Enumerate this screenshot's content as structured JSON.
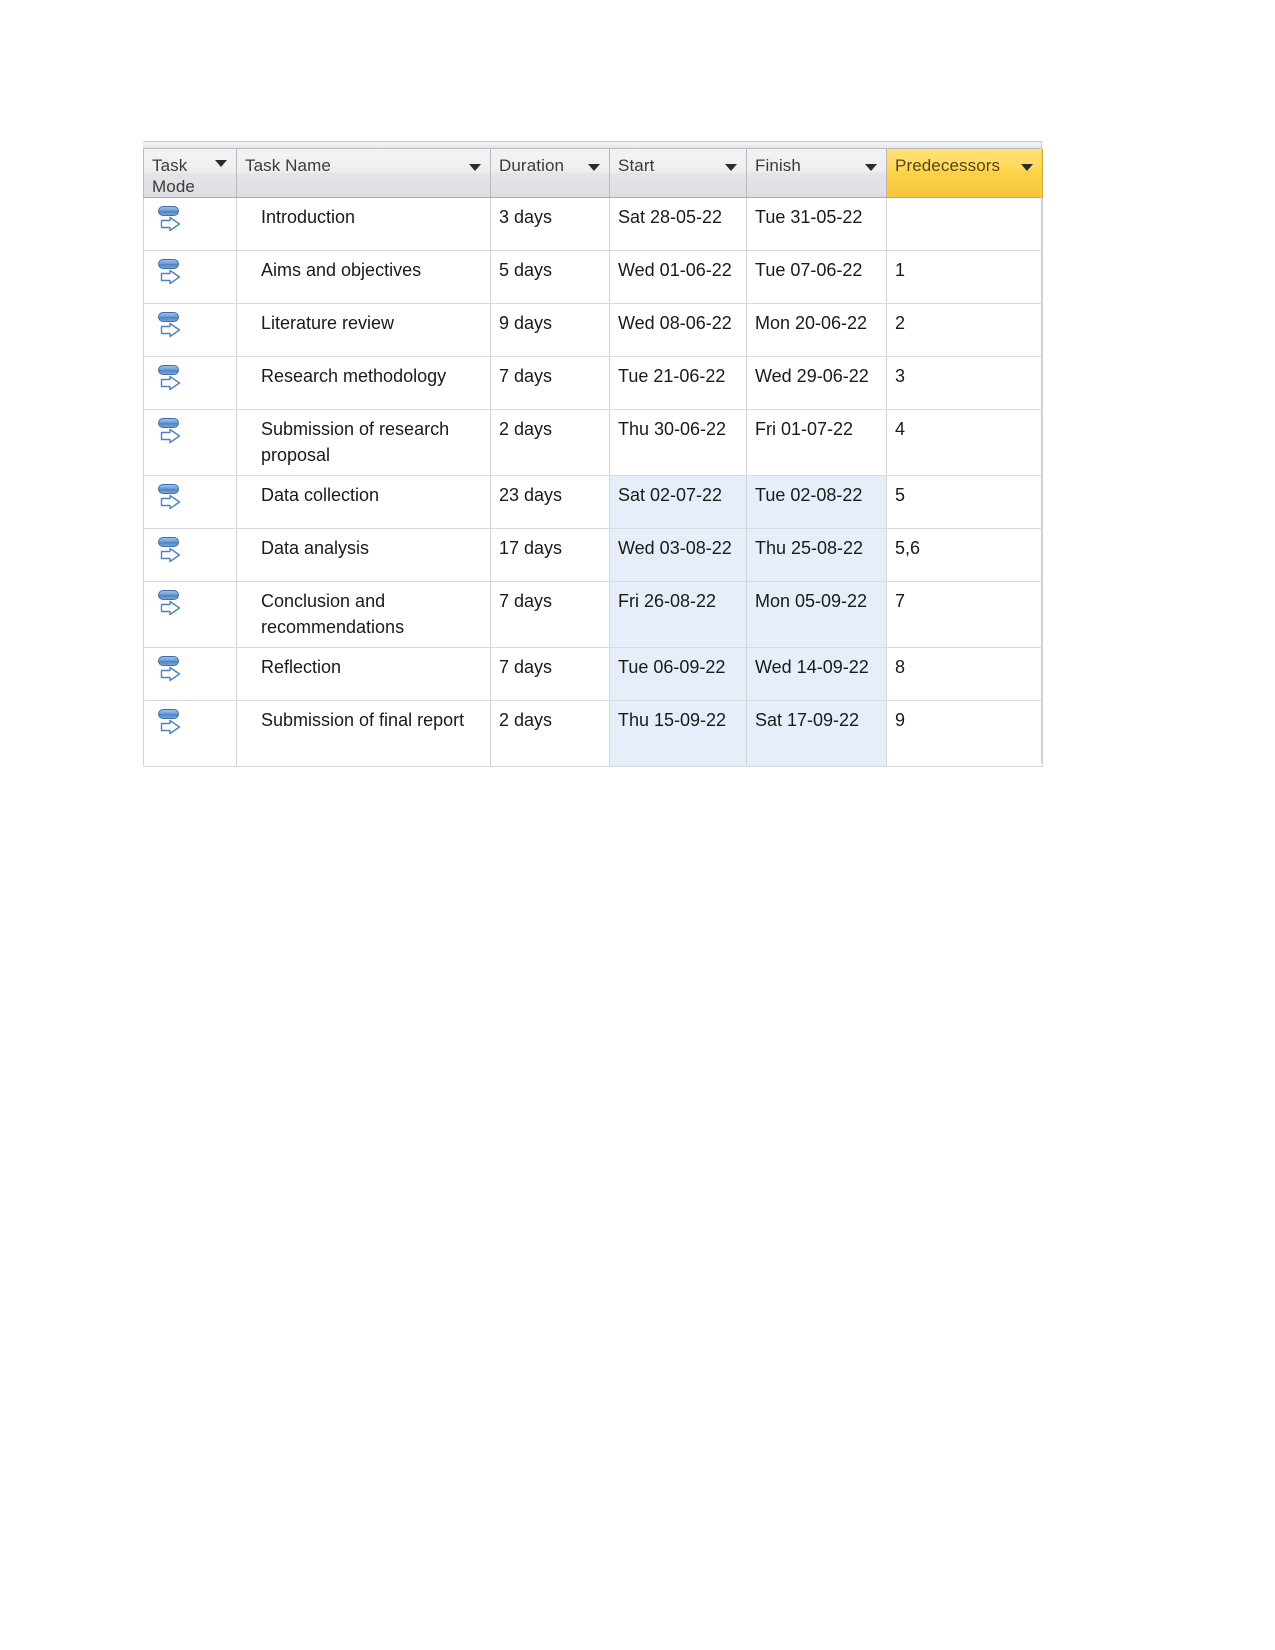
{
  "table": {
    "columns": [
      {
        "id": "task_mode",
        "label_line1": "Task",
        "label_line2": "Mode",
        "has_filter": true,
        "highlighted": false
      },
      {
        "id": "task_name",
        "label_line1": "Task Name",
        "label_line2": "",
        "has_filter": true,
        "highlighted": false
      },
      {
        "id": "duration",
        "label_line1": "Duration",
        "label_line2": "",
        "has_filter": true,
        "highlighted": false
      },
      {
        "id": "start",
        "label_line1": "Start",
        "label_line2": "",
        "has_filter": true,
        "highlighted": false
      },
      {
        "id": "finish",
        "label_line1": "Finish",
        "label_line2": "",
        "has_filter": true,
        "highlighted": false
      },
      {
        "id": "predecessors",
        "label_line1": "Predecessors",
        "label_line2": "",
        "has_filter": true,
        "highlighted": true
      }
    ],
    "rows": [
      {
        "task_mode_icon": "auto-scheduled-icon",
        "task_name": "Introduction",
        "duration": "3 days",
        "start": "Sat 28-05-22",
        "finish": "Tue 31-05-22",
        "predecessors": "",
        "selected": false,
        "tall": false
      },
      {
        "task_mode_icon": "auto-scheduled-icon",
        "task_name": "Aims and objectives",
        "duration": "5 days",
        "start": "Wed 01-06-22",
        "finish": "Tue 07-06-22",
        "predecessors": "1",
        "selected": false,
        "tall": false
      },
      {
        "task_mode_icon": "auto-scheduled-icon",
        "task_name": "Literature review",
        "duration": "9 days",
        "start": "Wed 08-06-22",
        "finish": "Mon 20-06-22",
        "predecessors": "2",
        "selected": false,
        "tall": false
      },
      {
        "task_mode_icon": "auto-scheduled-icon",
        "task_name": "Research methodology",
        "duration": "7 days",
        "start": "Tue 21-06-22",
        "finish": "Wed 29-06-22",
        "predecessors": "3",
        "selected": false,
        "tall": false
      },
      {
        "task_mode_icon": "auto-scheduled-icon",
        "task_name": "Submission of research proposal",
        "duration": "2 days",
        "start": "Thu 30-06-22",
        "finish": "Fri 01-07-22",
        "predecessors": "4",
        "selected": false,
        "tall": true
      },
      {
        "task_mode_icon": "auto-scheduled-icon",
        "task_name": "Data collection",
        "duration": "23 days",
        "start": "Sat 02-07-22",
        "finish": "Tue 02-08-22",
        "predecessors": "5",
        "selected": true,
        "tall": false
      },
      {
        "task_mode_icon": "auto-scheduled-icon",
        "task_name": "Data analysis",
        "duration": "17 days",
        "start": "Wed 03-08-22",
        "finish": "Thu 25-08-22",
        "predecessors": "5,6",
        "selected": true,
        "tall": false
      },
      {
        "task_mode_icon": "auto-scheduled-icon",
        "task_name": "Conclusion and recommendations",
        "duration": "7 days",
        "start": "Fri 26-08-22",
        "finish": "Mon 05-09-22",
        "predecessors": "7",
        "selected": true,
        "tall": true
      },
      {
        "task_mode_icon": "auto-scheduled-icon",
        "task_name": "Reflection",
        "duration": "7 days",
        "start": "Tue 06-09-22",
        "finish": "Wed 14-09-22",
        "predecessors": "8",
        "selected": true,
        "tall": false
      },
      {
        "task_mode_icon": "auto-scheduled-icon",
        "task_name": "Submission of final report",
        "duration": "2 days",
        "start": "Thu 15-09-22",
        "finish": "Sat 17-09-22",
        "predecessors": "9",
        "selected": true,
        "tall": true
      }
    ]
  },
  "colors": {
    "header_highlight": "#ffd95b",
    "selection_fill": "#e6eff9",
    "grid_line": "#d2d4d8",
    "header_text": "#3b3b3b",
    "task_mode_icon_blue": "#4f82c2"
  }
}
